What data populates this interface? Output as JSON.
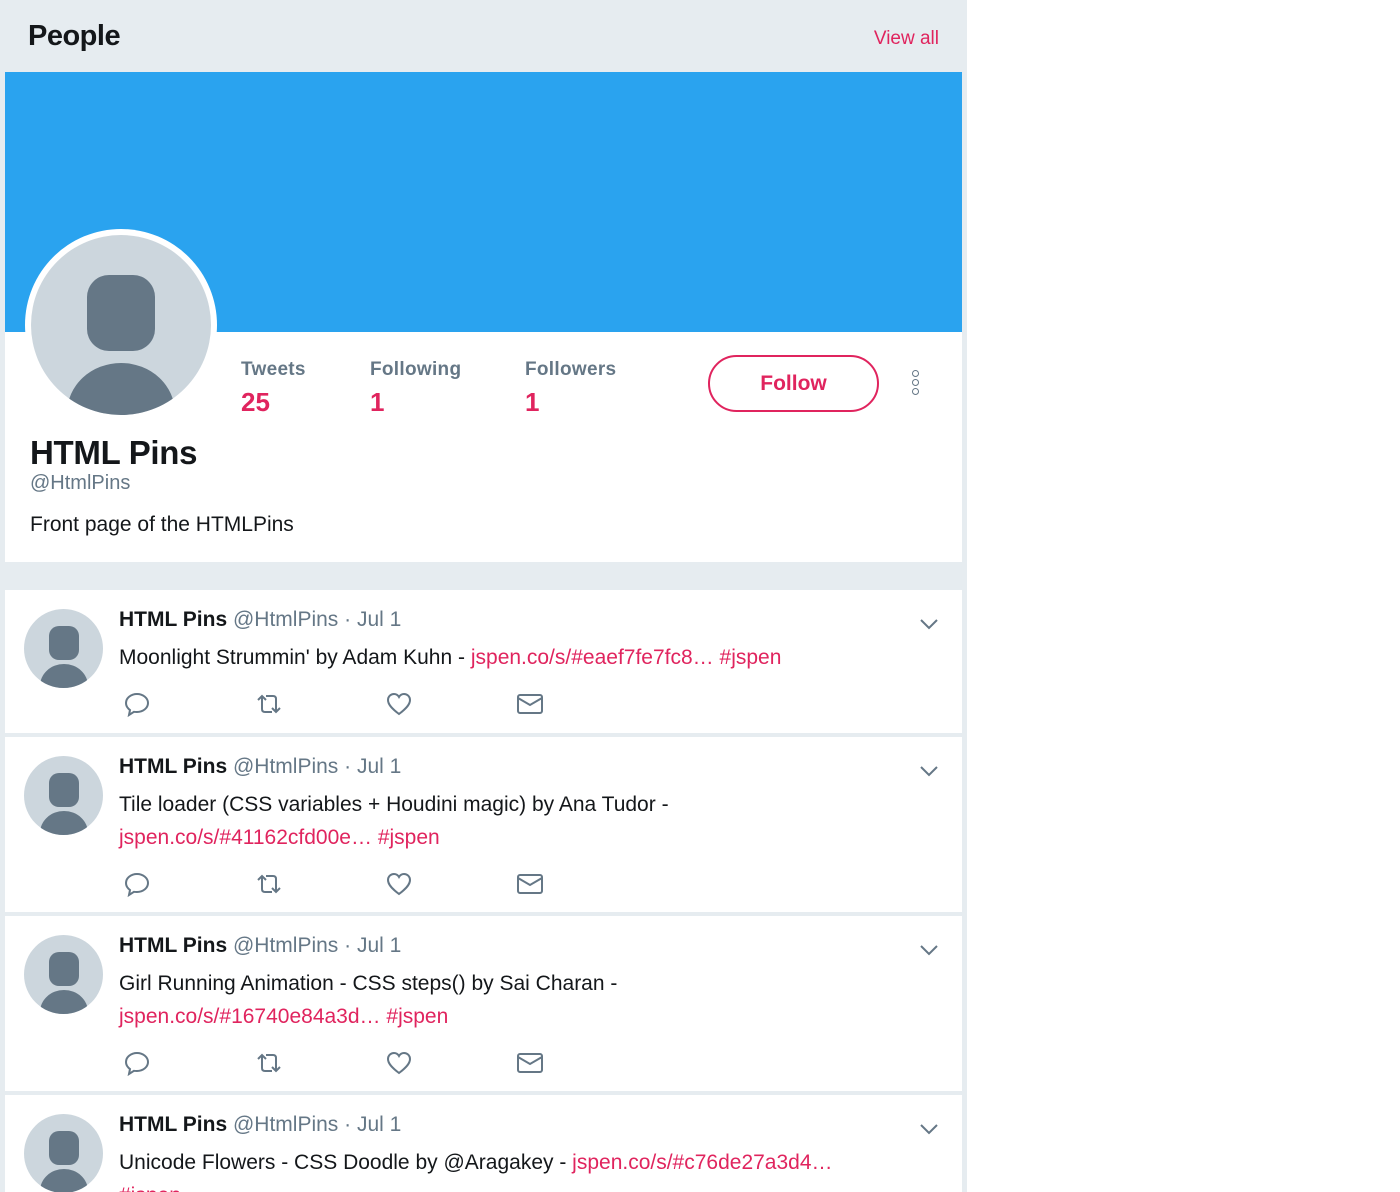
{
  "people": {
    "title": "People",
    "view_all": "View all"
  },
  "profile": {
    "banner_color": "#2aa3ef",
    "name": "HTML Pins",
    "handle": "@HtmlPins",
    "bio": "Front page of the HTMLPins",
    "stats": {
      "tweets_label": "Tweets",
      "tweets_value": "25",
      "following_label": "Following",
      "following_value": "1",
      "followers_label": "Followers",
      "followers_value": "1"
    },
    "follow_label": "Follow"
  },
  "tweets": [
    {
      "name": "HTML Pins",
      "handle": "@HtmlPins",
      "sep": "·",
      "date": "Jul 1",
      "text": "Moonlight Strummin' by Adam Kuhn -",
      "link": "jspen.co/s/#eaef7fe7fc8…",
      "hashtag": "#jspen"
    },
    {
      "name": "HTML Pins",
      "handle": "@HtmlPins",
      "sep": "·",
      "date": "Jul 1",
      "text": "Tile loader (CSS variables + Houdini magic) by Ana Tudor -",
      "link": "jspen.co/s/#41162cfd00e…",
      "hashtag": "#jspen"
    },
    {
      "name": "HTML Pins",
      "handle": "@HtmlPins",
      "sep": "·",
      "date": "Jul 1",
      "text": "Girl Running Animation - CSS steps() by Sai Charan -",
      "link": "jspen.co/s/#16740e84a3d…",
      "hashtag": "#jspen"
    },
    {
      "name": "HTML Pins",
      "handle": "@HtmlPins",
      "sep": "·",
      "date": "Jul 1",
      "text": "Unicode Flowers - CSS Doodle by @Aragakey -",
      "link": "jspen.co/s/#c76de27a3d4…",
      "hashtag": "#jspen"
    }
  ],
  "icons": {
    "reply": "reply-icon",
    "retweet": "retweet-icon",
    "like": "heart-icon",
    "dm": "mail-icon",
    "caret": "chevron-down-icon",
    "more": "more-vertical-icon"
  },
  "colors": {
    "accent": "#e0245e",
    "background": "#e6ecf0",
    "muted": "#657786"
  }
}
